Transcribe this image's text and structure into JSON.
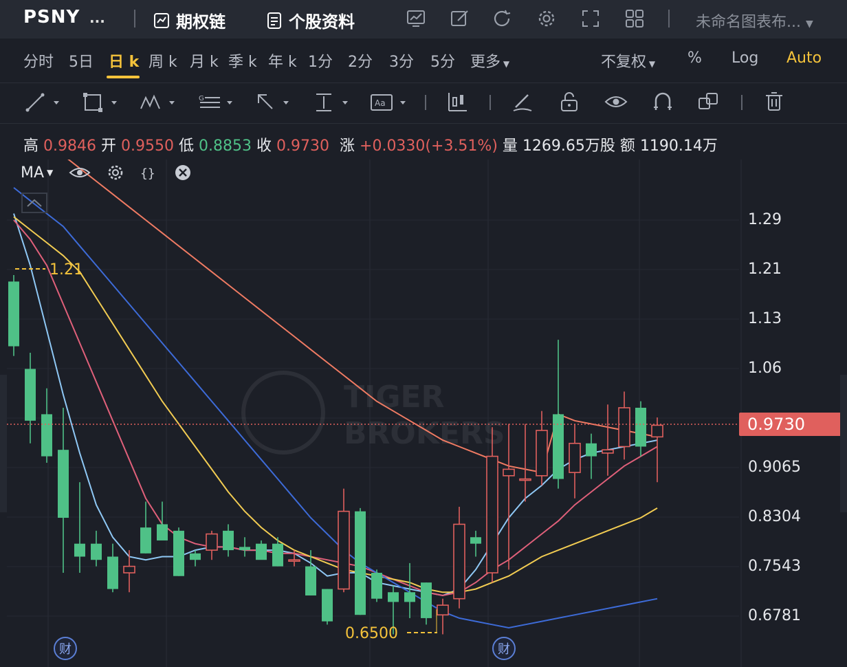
{
  "header": {
    "ticker": "PSNY",
    "more": "...",
    "options_chain_label": "期权链",
    "stock_info_label": "个股资料",
    "chart_name": "未命名图表布..."
  },
  "periods": {
    "items": [
      "分时",
      "5日",
      "日 k",
      "周 k",
      "月 k",
      "季 k",
      "年 k",
      "1分",
      "2分",
      "3分",
      "5分",
      "更多"
    ],
    "active": "日 k",
    "adjust": "不复权",
    "percent": "%",
    "log": "Log",
    "auto": "Auto"
  },
  "quote": {
    "high_label": "高",
    "high": "0.9846",
    "open_label": "开",
    "open": "0.9550",
    "low_label": "低",
    "low": "0.8853",
    "close_label": "收",
    "close": "0.9730",
    "change_label": "涨",
    "change": "+0.0330(+3.51%)",
    "volume_label": "量",
    "volume": "1269.65万股",
    "amount_label": "额",
    "amount": "1190.14万"
  },
  "indicator": {
    "name": "MA"
  },
  "price_axis": [
    "1.29",
    "1.21",
    "1.13",
    "1.06",
    "0.9065",
    "0.8304",
    "0.7543",
    "0.6781"
  ],
  "current_price": "0.9730",
  "annotations": {
    "high_marker": "1.21",
    "low_marker": "0.6500",
    "finance_badge": "财"
  },
  "watermark": [
    "TIGER",
    "BROKERS"
  ],
  "colors": {
    "up": "#e0605d",
    "down": "#4fc187",
    "accent": "#f5c33b",
    "bg": "#1c1f27"
  },
  "chart_data": {
    "type": "candlestick",
    "ylim": [
      0.64,
      1.33
    ],
    "candles": [
      {
        "o": 1.195,
        "h": 1.205,
        "l": 1.08,
        "c": 1.095
      },
      {
        "o": 1.06,
        "h": 1.085,
        "l": 0.945,
        "c": 0.98
      },
      {
        "o": 0.99,
        "h": 1.03,
        "l": 0.915,
        "c": 0.925
      },
      {
        "o": 0.935,
        "h": 1.0,
        "l": 0.745,
        "c": 0.83
      },
      {
        "o": 0.79,
        "h": 0.885,
        "l": 0.745,
        "c": 0.77
      },
      {
        "o": 0.79,
        "h": 0.81,
        "l": 0.755,
        "c": 0.765
      },
      {
        "o": 0.77,
        "h": 0.79,
        "l": 0.715,
        "c": 0.72
      },
      {
        "o": 0.745,
        "h": 0.78,
        "l": 0.715,
        "c": 0.755
      },
      {
        "o": 0.815,
        "h": 0.855,
        "l": 0.775,
        "c": 0.775
      },
      {
        "o": 0.82,
        "h": 0.855,
        "l": 0.805,
        "c": 0.795
      },
      {
        "o": 0.81,
        "h": 0.815,
        "l": 0.74,
        "c": 0.74
      },
      {
        "o": 0.775,
        "h": 0.78,
        "l": 0.755,
        "c": 0.765
      },
      {
        "o": 0.78,
        "h": 0.81,
        "l": 0.765,
        "c": 0.805
      },
      {
        "o": 0.81,
        "h": 0.82,
        "l": 0.77,
        "c": 0.78
      },
      {
        "o": 0.785,
        "h": 0.8,
        "l": 0.77,
        "c": 0.78
      },
      {
        "o": 0.79,
        "h": 0.795,
        "l": 0.77,
        "c": 0.765
      },
      {
        "o": 0.79,
        "h": 0.8,
        "l": 0.755,
        "c": 0.755
      },
      {
        "o": 0.765,
        "h": 0.78,
        "l": 0.755,
        "c": 0.765
      },
      {
        "o": 0.755,
        "h": 0.78,
        "l": 0.71,
        "c": 0.71
      },
      {
        "o": 0.72,
        "h": 0.72,
        "l": 0.665,
        "c": 0.67
      },
      {
        "o": 0.72,
        "h": 0.875,
        "l": 0.715,
        "c": 0.84
      },
      {
        "o": 0.84,
        "h": 0.845,
        "l": 0.68,
        "c": 0.68
      },
      {
        "o": 0.745,
        "h": 0.75,
        "l": 0.7,
        "c": 0.705
      },
      {
        "o": 0.715,
        "h": 0.725,
        "l": 0.65,
        "c": 0.7
      },
      {
        "o": 0.715,
        "h": 0.76,
        "l": 0.675,
        "c": 0.7
      },
      {
        "o": 0.73,
        "h": 0.73,
        "l": 0.665,
        "c": 0.675
      },
      {
        "o": 0.68,
        "h": 0.705,
        "l": 0.65,
        "c": 0.695
      },
      {
        "o": 0.705,
        "h": 0.847,
        "l": 0.69,
        "c": 0.82
      },
      {
        "o": 0.8,
        "h": 0.81,
        "l": 0.77,
        "c": 0.79
      },
      {
        "o": 0.745,
        "h": 0.97,
        "l": 0.73,
        "c": 0.925
      },
      {
        "o": 0.895,
        "h": 0.975,
        "l": 0.75,
        "c": 0.905
      },
      {
        "o": 0.89,
        "h": 0.975,
        "l": 0.855,
        "c": 0.89
      },
      {
        "o": 0.895,
        "h": 0.995,
        "l": 0.88,
        "c": 0.965
      },
      {
        "o": 0.99,
        "h": 1.105,
        "l": 0.875,
        "c": 0.89
      },
      {
        "o": 0.9,
        "h": 0.975,
        "l": 0.86,
        "c": 0.945
      },
      {
        "o": 0.945,
        "h": 0.96,
        "l": 0.89,
        "c": 0.925
      },
      {
        "o": 0.93,
        "h": 1.005,
        "l": 0.895,
        "c": 0.935
      },
      {
        "o": 0.94,
        "h": 1.025,
        "l": 0.92,
        "c": 1.0
      },
      {
        "o": 1.0,
        "h": 1.01,
        "l": 0.925,
        "c": 0.94
      },
      {
        "o": 0.955,
        "h": 0.985,
        "l": 0.885,
        "c": 0.973
      }
    ],
    "ma_lines": [
      {
        "color": "#8fc8f5",
        "values": [
          1.3,
          1.22,
          1.12,
          1.02,
          0.93,
          0.85,
          0.8,
          0.77,
          0.765,
          0.77,
          0.77,
          0.78,
          0.785,
          0.785,
          0.78,
          0.78,
          0.78,
          0.775,
          0.76,
          0.74,
          0.745,
          0.745,
          0.73,
          0.725,
          0.72,
          0.715,
          0.71,
          0.72,
          0.75,
          0.79,
          0.83,
          0.86,
          0.88,
          0.905,
          0.92,
          0.93,
          0.935,
          0.94,
          0.945,
          0.95
        ]
      },
      {
        "color": "#e0607a",
        "values": [
          1.29,
          1.26,
          1.22,
          1.16,
          1.1,
          1.04,
          0.98,
          0.92,
          0.86,
          0.82,
          0.8,
          0.79,
          0.785,
          0.785,
          0.78,
          0.78,
          0.775,
          0.775,
          0.77,
          0.765,
          0.76,
          0.755,
          0.745,
          0.735,
          0.725,
          0.715,
          0.71,
          0.715,
          0.73,
          0.75,
          0.765,
          0.785,
          0.805,
          0.825,
          0.85,
          0.87,
          0.89,
          0.91,
          0.925,
          0.94
        ]
      },
      {
        "color": "#f2cc52",
        "values": [
          1.295,
          1.275,
          1.255,
          1.235,
          1.21,
          1.17,
          1.13,
          1.09,
          1.05,
          1.01,
          0.975,
          0.94,
          0.905,
          0.87,
          0.84,
          0.815,
          0.795,
          0.78,
          0.77,
          0.76,
          0.75,
          0.745,
          0.74,
          0.735,
          0.73,
          0.72,
          0.715,
          0.715,
          0.72,
          0.73,
          0.74,
          0.755,
          0.77,
          0.78,
          0.79,
          0.8,
          0.81,
          0.82,
          0.83,
          0.845
        ]
      },
      {
        "color": "#3d6bd8",
        "values": [
          1.34,
          1.32,
          1.3,
          1.28,
          1.25,
          1.22,
          1.19,
          1.16,
          1.13,
          1.1,
          1.07,
          1.04,
          1.01,
          0.98,
          0.95,
          0.92,
          0.89,
          0.86,
          0.83,
          0.805,
          0.78,
          0.76,
          0.745,
          0.73,
          0.715,
          0.7,
          0.685,
          0.675,
          0.67,
          0.665,
          0.66,
          0.665,
          0.67,
          0.675,
          0.68,
          0.685,
          0.69,
          0.695,
          0.7,
          0.705
        ]
      },
      {
        "color": "#f07b63",
        "values": [
          1.45,
          1.43,
          1.41,
          1.39,
          1.37,
          1.35,
          1.33,
          1.31,
          1.29,
          1.27,
          1.25,
          1.23,
          1.21,
          1.19,
          1.17,
          1.15,
          1.13,
          1.11,
          1.09,
          1.07,
          1.05,
          1.03,
          1.01,
          0.995,
          0.98,
          0.965,
          0.95,
          0.94,
          0.93,
          0.92,
          0.91,
          0.905,
          0.9,
          0.99,
          0.98,
          0.975,
          0.97,
          0.965,
          0.96,
          0.955
        ]
      }
    ]
  }
}
